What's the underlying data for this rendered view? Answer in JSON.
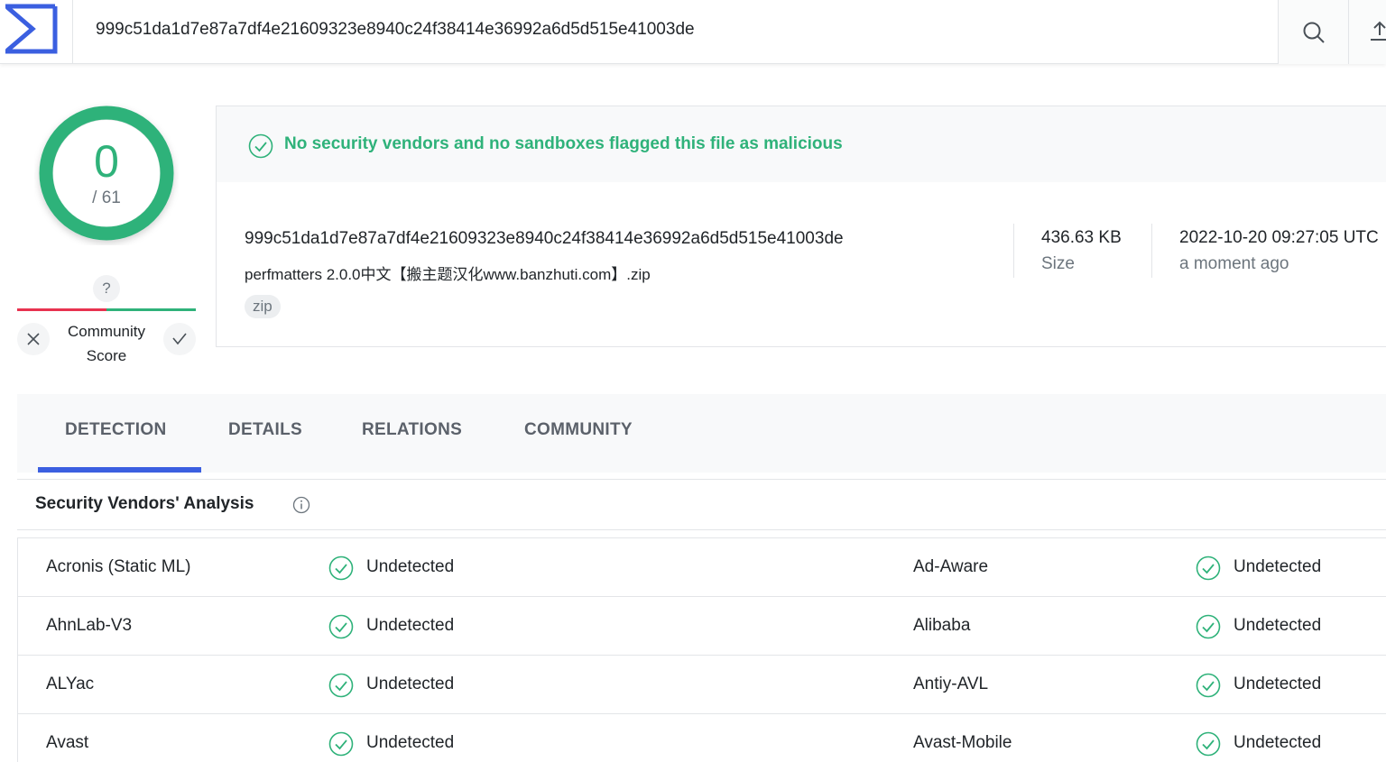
{
  "header": {
    "search_value": "999c51da1d7e87a7df4e21609323e8940c24f38414e36992a6d5d515e41003de",
    "logo_icon": "sigma-logo-icon",
    "search_icon": "search-icon",
    "upload_icon": "upload-icon",
    "colors": {
      "brand": "#3b5fe0"
    }
  },
  "score": {
    "detected": "0",
    "total": "/ 61",
    "color": "#2fb27a"
  },
  "community": {
    "badge": "?",
    "label_line1": "Community",
    "label_line2": "Score",
    "down_icon": "close-icon",
    "up_icon": "check-icon"
  },
  "summary": {
    "verdict": "No security vendors and no sandboxes flagged this file as malicious",
    "file_hash": "999c51da1d7e87a7df4e21609323e8940c24f38414e36992a6d5d515e41003de",
    "file_name": "perfmatters 2.0.0中文【搬主题汉化www.banzhuti.com】.zip",
    "tag": "zip",
    "size_value": "436.63 KB",
    "size_label": "Size",
    "date_value": "2022-10-20 09:27:05 UTC",
    "date_label": "a moment ago"
  },
  "tabs": [
    {
      "label": "DETECTION",
      "active": true
    },
    {
      "label": "DETAILS",
      "active": false
    },
    {
      "label": "RELATIONS",
      "active": false
    },
    {
      "label": "COMMUNITY",
      "active": false
    }
  ],
  "analysis": {
    "title": "Security Vendors' Analysis",
    "rows": [
      {
        "left_vendor": "Acronis (Static ML)",
        "left_result": "Undetected",
        "right_vendor": "Ad-Aware",
        "right_result": "Undetected"
      },
      {
        "left_vendor": "AhnLab-V3",
        "left_result": "Undetected",
        "right_vendor": "Alibaba",
        "right_result": "Undetected"
      },
      {
        "left_vendor": "ALYac",
        "left_result": "Undetected",
        "right_vendor": "Antiy-AVL",
        "right_result": "Undetected"
      },
      {
        "left_vendor": "Avast",
        "left_result": "Undetected",
        "right_vendor": "Avast-Mobile",
        "right_result": "Undetected"
      }
    ]
  }
}
